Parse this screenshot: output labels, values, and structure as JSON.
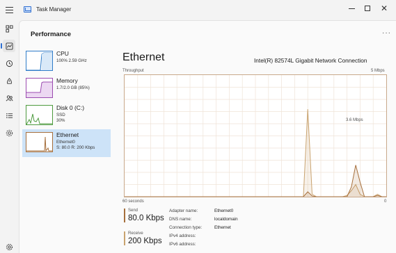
{
  "window": {
    "title": "Task Manager",
    "minimize_glyph": "",
    "maximize_glyph": "",
    "close_glyph": "✕"
  },
  "rail": {
    "icons": [
      "hamburger-icon",
      "processes-icon",
      "performance-icon",
      "app-history-icon",
      "startup-apps-icon",
      "users-icon",
      "details-icon",
      "services-icon",
      "settings-icon"
    ]
  },
  "page": {
    "title": "Performance",
    "more_glyph": "···"
  },
  "resources": [
    {
      "name": "CPU",
      "sub1": "100% 2.59 GHz",
      "sub2": "",
      "sub3": "",
      "color": "#2f7cc9"
    },
    {
      "name": "Memory",
      "sub1": "1.7/2.0 GB (85%)",
      "sub2": "",
      "sub3": "",
      "color": "#9b4cb0"
    },
    {
      "name": "Disk 0 (C:)",
      "sub1": "SSD",
      "sub2": "30%",
      "sub3": "",
      "color": "#4d9a3e"
    },
    {
      "name": "Ethernet",
      "sub1": "Ethernet0",
      "sub2": "S: 80.0  R: 200 Kbps",
      "sub3": "",
      "color": "#a66f3c"
    }
  ],
  "detail": {
    "title": "Ethernet",
    "adapter": "Intel(R) 82574L Gigabit Network Connection",
    "throughput_label": "Throughput",
    "max_label": "5 Mbps",
    "mid_label": "3.6 Mbps",
    "time_label": "60 seconds",
    "zero_label": "0",
    "send_label": "Send",
    "send_value": "80.0 Kbps",
    "receive_label": "Receive",
    "receive_value": "200 Kbps",
    "send_color": "#a66f3c",
    "receive_color": "#c9a36f"
  },
  "properties": [
    {
      "label": "Adapter name:",
      "value": "Ethernet0"
    },
    {
      "label": "DNS name:",
      "value": "localdomain"
    },
    {
      "label": "Connection type:",
      "value": "Ethernet"
    },
    {
      "label": "IPv4 address:",
      "value": ""
    },
    {
      "label": "IPv6 address:",
      "value": ""
    }
  ],
  "chart_data": {
    "type": "line",
    "title": "",
    "xlabel": "60 seconds",
    "ylabel": "Throughput",
    "ylim": [
      0,
      5
    ],
    "y_unit": "Mbps",
    "grid": true,
    "x": [
      60,
      57,
      54,
      51,
      48,
      45,
      42,
      39,
      36,
      33,
      30,
      27,
      24,
      23,
      22,
      21,
      20,
      19,
      18,
      17,
      16,
      15,
      14,
      13,
      12,
      11,
      10,
      9,
      8,
      7,
      6,
      5,
      4,
      3,
      2,
      1,
      0
    ],
    "series": [
      {
        "name": "Receive",
        "values": [
          0,
          0,
          0,
          0,
          0,
          0,
          0,
          0,
          0,
          0,
          0,
          0,
          0,
          0,
          0,
          0,
          0,
          0,
          3.6,
          0.1,
          0,
          0,
          0,
          0,
          0,
          0,
          0,
          0.05,
          0.25,
          0.5,
          0.1,
          0,
          0,
          0,
          0.1,
          0,
          0
        ]
      },
      {
        "name": "Send",
        "values": [
          0,
          0,
          0,
          0,
          0,
          0,
          0,
          0,
          0,
          0,
          0,
          0,
          0,
          0,
          0,
          0,
          0,
          0,
          0.2,
          0.03,
          0,
          0,
          0,
          0,
          0,
          0,
          0,
          0,
          0.4,
          1.3,
          0.6,
          0,
          0,
          0,
          0.05,
          0,
          0
        ]
      }
    ]
  }
}
